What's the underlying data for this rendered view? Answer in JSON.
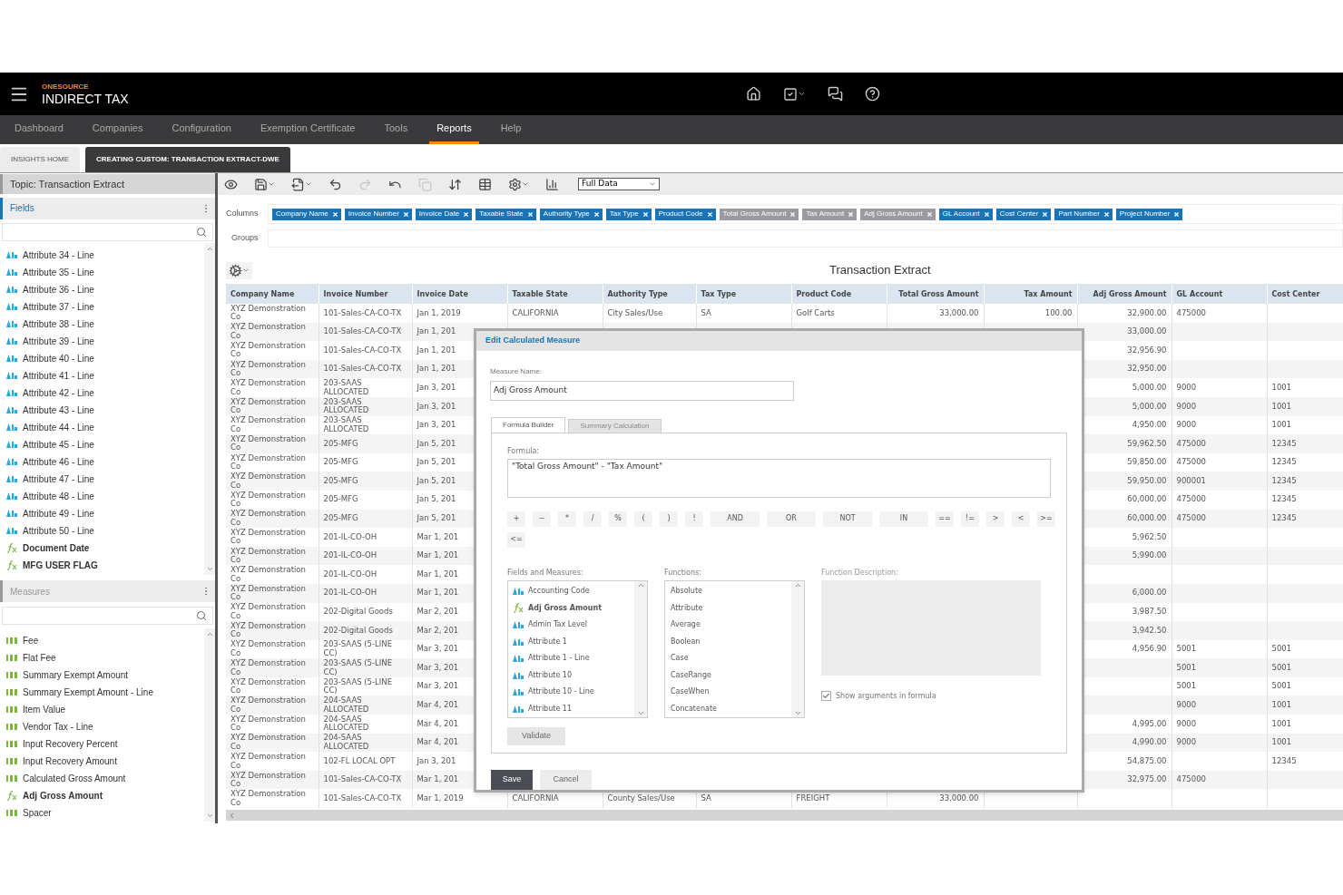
{
  "header": {
    "brand": "ONESOURCE",
    "product": "INDIRECT TAX"
  },
  "nav": [
    {
      "label": "Dashboard",
      "selected": false
    },
    {
      "label": "Companies",
      "selected": false
    },
    {
      "label": "Configuration",
      "selected": false
    },
    {
      "label": "Exemption Certificate",
      "selected": false
    },
    {
      "label": "Tools",
      "selected": false
    },
    {
      "label": "Reports",
      "selected": true
    },
    {
      "label": "Help",
      "selected": false
    }
  ],
  "tabs": [
    {
      "label": "INSIGHTS HOME",
      "selected": false
    },
    {
      "label": "CREATING CUSTOM: TRANSACTION EXTRACT-DWE",
      "selected": true
    }
  ],
  "sidebar": {
    "topic": "Topic: Transaction Extract",
    "fields": {
      "title": "Fields",
      "active": true,
      "items": [
        {
          "label": "Attribute 34 - Line",
          "kind": "text"
        },
        {
          "label": "Attribute 35 - Line",
          "kind": "text"
        },
        {
          "label": "Attribute 36 - Line",
          "kind": "text"
        },
        {
          "label": "Attribute 37 - Line",
          "kind": "text"
        },
        {
          "label": "Attribute 38 - Line",
          "kind": "text"
        },
        {
          "label": "Attribute 39 - Line",
          "kind": "text"
        },
        {
          "label": "Attribute 40 - Line",
          "kind": "text"
        },
        {
          "label": "Attribute 41 - Line",
          "kind": "text"
        },
        {
          "label": "Attribute 42 - Line",
          "kind": "text"
        },
        {
          "label": "Attribute 43 - Line",
          "kind": "text"
        },
        {
          "label": "Attribute 44 - Line",
          "kind": "text"
        },
        {
          "label": "Attribute 45 - Line",
          "kind": "text"
        },
        {
          "label": "Attribute 46 - Line",
          "kind": "text"
        },
        {
          "label": "Attribute 47 - Line",
          "kind": "text"
        },
        {
          "label": "Attribute 48 - Line",
          "kind": "text"
        },
        {
          "label": "Attribute 49 - Line",
          "kind": "text"
        },
        {
          "label": "Attribute 50 - Line",
          "kind": "text"
        },
        {
          "label": "Document Date",
          "kind": "formula"
        },
        {
          "label": "MFG USER FLAG",
          "kind": "formula"
        }
      ]
    },
    "measures": {
      "title": "Measures",
      "active": false,
      "items": [
        {
          "label": "Fee",
          "kind": "number"
        },
        {
          "label": "Flat Fee",
          "kind": "number"
        },
        {
          "label": "Summary Exempt Amount",
          "kind": "number"
        },
        {
          "label": "Summary Exempt Amount - Line",
          "kind": "number"
        },
        {
          "label": "Item Value",
          "kind": "number"
        },
        {
          "label": "Vendor Tax - Line",
          "kind": "number"
        },
        {
          "label": "Input Recovery Percent",
          "kind": "number"
        },
        {
          "label": "Input Recovery Amount",
          "kind": "number"
        },
        {
          "label": "Calculated Gross Amount",
          "kind": "number"
        },
        {
          "label": "Adj Gross Amount",
          "kind": "formula"
        },
        {
          "label": "Spacer",
          "kind": "number"
        }
      ]
    }
  },
  "toolbar": {
    "buttons": [
      {
        "kind": "view",
        "caret": false,
        "disabled": false
      },
      {
        "kind": "save",
        "caret": true,
        "disabled": false
      },
      {
        "kind": "export",
        "caret": true,
        "disabled": false
      },
      {
        "kind": "undo",
        "caret": false,
        "disabled": false
      },
      {
        "kind": "redo",
        "caret": false,
        "disabled": true
      },
      {
        "kind": "reset",
        "caret": false,
        "disabled": false
      },
      {
        "kind": "copy",
        "caret": false,
        "disabled": true
      },
      {
        "kind": "sort",
        "caret": false,
        "disabled": false
      },
      {
        "kind": "layout",
        "caret": false,
        "disabled": false
      },
      {
        "kind": "settings",
        "caret": true,
        "disabled": false
      },
      {
        "kind": "chart",
        "caret": false,
        "disabled": false
      }
    ],
    "view_select": "Full Data"
  },
  "columns_label": "Columns",
  "column_chips": [
    {
      "label": "Company Name",
      "kind": "field"
    },
    {
      "label": "Invoice Number",
      "kind": "field"
    },
    {
      "label": "Invoice Date",
      "kind": "field"
    },
    {
      "label": "Taxable State",
      "kind": "field"
    },
    {
      "label": "Authority Type",
      "kind": "field"
    },
    {
      "label": "Tax Type",
      "kind": "field"
    },
    {
      "label": "Product Code",
      "kind": "field"
    },
    {
      "label": "Total Gross Amount",
      "kind": "measure"
    },
    {
      "label": "Tax Amount",
      "kind": "measure"
    },
    {
      "label": "Adj Gross Amount",
      "kind": "measure"
    },
    {
      "label": "GL Account",
      "kind": "field"
    },
    {
      "label": "Cost Center",
      "kind": "field"
    },
    {
      "label": "Part Number",
      "kind": "field"
    },
    {
      "label": "Project Number",
      "kind": "field"
    }
  ],
  "groups_label": "Groups",
  "report": {
    "title": "Transaction Extract",
    "table": {
      "columns": [
        {
          "label": "Company Name",
          "kind": "text"
        },
        {
          "label": "Invoice Number",
          "kind": "text"
        },
        {
          "label": "Invoice Date",
          "kind": "date"
        },
        {
          "label": "Taxable State",
          "kind": "text"
        },
        {
          "label": "Authority Type",
          "kind": "text"
        },
        {
          "label": "Tax Type",
          "kind": "text"
        },
        {
          "label": "Product Code",
          "kind": "text"
        },
        {
          "label": "Total Gross Amount",
          "kind": "amount"
        },
        {
          "label": "Tax Amount",
          "kind": "amount"
        },
        {
          "label": "Adj Gross Amount",
          "kind": "amount"
        },
        {
          "label": "GL Account",
          "kind": "text"
        },
        {
          "label": "Cost Center",
          "kind": "text"
        }
      ],
      "rows": [
        {
          "cells": [
            "XYZ Demonstration Co",
            "101-Sales-CA-CO-TX",
            "Jan 1, 2019",
            "CALIFORNIA",
            "City Sales/Use",
            "SA",
            "Golf Carts",
            "33,000.00",
            "100.00",
            "32,900.00",
            "475000",
            null
          ]
        },
        {
          "cells": [
            "XYZ Demonstration Co",
            "101-Sales-CA-CO-TX",
            "Jan 1, 201",
            null,
            null,
            null,
            null,
            null,
            null,
            "33,000.00",
            null,
            null
          ]
        },
        {
          "cells": [
            "XYZ Demonstration Co",
            "101-Sales-CA-CO-TX",
            "Jan 1, 201",
            null,
            null,
            null,
            null,
            null,
            null,
            "32,956.90",
            null,
            null
          ]
        },
        {
          "cells": [
            "XYZ Demonstration Co",
            "101-Sales-CA-CO-TX",
            "Jan 1, 201",
            null,
            null,
            null,
            null,
            null,
            null,
            "32,950.00",
            null,
            null
          ]
        },
        {
          "cells": [
            "XYZ Demonstration Co",
            "203-SAAS ALLOCATED",
            "Jan 3, 201",
            null,
            null,
            null,
            null,
            null,
            null,
            "5,000.00",
            "9000",
            "1001"
          ]
        },
        {
          "cells": [
            "XYZ Demonstration Co",
            "203-SAAS ALLOCATED",
            "Jan 3, 201",
            null,
            null,
            null,
            null,
            null,
            null,
            "5,000.00",
            "9000",
            "1001"
          ]
        },
        {
          "cells": [
            "XYZ Demonstration Co",
            "203-SAAS ALLOCATED",
            "Jan 3, 201",
            null,
            null,
            null,
            null,
            null,
            null,
            "4,950.00",
            "9000",
            "1001"
          ]
        },
        {
          "cells": [
            "XYZ Demonstration Co",
            "205-MFG",
            "Jan 5, 201",
            null,
            null,
            null,
            null,
            null,
            null,
            "59,962.50",
            "475000",
            "12345"
          ]
        },
        {
          "cells": [
            "XYZ Demonstration Co",
            "205-MFG",
            "Jan 5, 201",
            null,
            null,
            null,
            null,
            null,
            null,
            "59,850.00",
            "475000",
            "12345"
          ]
        },
        {
          "cells": [
            "XYZ Demonstration Co",
            "205-MFG",
            "Jan 5, 201",
            null,
            null,
            null,
            null,
            null,
            null,
            "59,950.00",
            "900001",
            "12345"
          ]
        },
        {
          "cells": [
            "XYZ Demonstration Co",
            "205-MFG",
            "Jan 5, 201",
            null,
            null,
            null,
            null,
            null,
            null,
            "60,000.00",
            "475000",
            "12345"
          ]
        },
        {
          "cells": [
            "XYZ Demonstration Co",
            "205-MFG",
            "Jan 5, 201",
            null,
            null,
            null,
            null,
            null,
            null,
            "60,000.00",
            "475000",
            "12345"
          ]
        },
        {
          "cells": [
            "XYZ Demonstration Co",
            "201-IL-CO-OH",
            "Mar 1, 201",
            null,
            null,
            null,
            null,
            null,
            null,
            "5,962.50",
            null,
            null
          ]
        },
        {
          "cells": [
            "XYZ Demonstration Co",
            "201-IL-CO-OH",
            "Mar 1, 201",
            null,
            null,
            null,
            null,
            null,
            null,
            "5,990.00",
            null,
            null
          ]
        },
        {
          "cells": [
            "XYZ Demonstration Co",
            "201-IL-CO-OH",
            "Mar 1, 201",
            null,
            null,
            null,
            null,
            null,
            null,
            null,
            null,
            null
          ]
        },
        {
          "cells": [
            "XYZ Demonstration Co",
            "201-IL-CO-OH",
            "Mar 1, 201",
            null,
            null,
            null,
            null,
            null,
            null,
            "6,000.00",
            null,
            null
          ]
        },
        {
          "cells": [
            "XYZ Demonstration Co",
            "202-Digital Goods",
            "Mar 2, 201",
            null,
            null,
            null,
            null,
            null,
            null,
            "3,987.50",
            null,
            null
          ]
        },
        {
          "cells": [
            "XYZ Demonstration Co",
            "202-Digital Goods",
            "Mar 2, 201",
            null,
            null,
            null,
            null,
            null,
            null,
            "3,942.50",
            null,
            null
          ]
        },
        {
          "cells": [
            "XYZ Demonstration Co",
            "203-SAAS (5-LINE CC)",
            "Mar 3, 201",
            null,
            null,
            null,
            null,
            null,
            null,
            "4,956.90",
            "5001",
            "5001"
          ]
        },
        {
          "cells": [
            "XYZ Demonstration Co",
            "203-SAAS (5-LINE CC)",
            "Mar 3, 201",
            null,
            null,
            null,
            null,
            null,
            null,
            null,
            "5001",
            "5001"
          ]
        },
        {
          "cells": [
            "XYZ Demonstration Co",
            "203-SAAS (5-LINE CC)",
            "Mar 3, 201",
            null,
            null,
            null,
            null,
            null,
            null,
            null,
            "5001",
            "5001"
          ]
        },
        {
          "cells": [
            "XYZ Demonstration Co",
            "204-SAAS ALLOCATED",
            "Mar 4, 201",
            null,
            null,
            null,
            null,
            null,
            null,
            null,
            "9000",
            "1001"
          ]
        },
        {
          "cells": [
            "XYZ Demonstration Co",
            "204-SAAS ALLOCATED",
            "Mar 4, 201",
            null,
            null,
            null,
            null,
            null,
            null,
            "4,995.00",
            "9000",
            "1001"
          ]
        },
        {
          "cells": [
            "XYZ Demonstration Co",
            "204-SAAS ALLOCATED",
            "Mar 4, 201",
            null,
            null,
            null,
            null,
            null,
            null,
            "4,990.00",
            "9000",
            "1001"
          ]
        },
        {
          "cells": [
            "XYZ Demonstration Co",
            "102-FL LOCAL OPT",
            "Jan 3, 201",
            null,
            null,
            null,
            null,
            null,
            null,
            "54,875.00",
            null,
            "12345"
          ]
        },
        {
          "cells": [
            "XYZ Demonstration Co",
            "101-Sales-CA-CO-TX",
            "Mar 1, 201",
            null,
            null,
            null,
            null,
            null,
            null,
            "32,975.00",
            "475000",
            null
          ]
        },
        {
          "cells": [
            "XYZ Demonstration Co",
            "101-Sales-CA-CO-TX",
            "Mar 1, 2019",
            "CALIFORNIA",
            "County Sales/Use",
            "SA",
            "FREIGHT",
            "33,000.00",
            null,
            null,
            null,
            null
          ]
        }
      ]
    }
  },
  "dialog": {
    "title": "Edit Calculated Measure",
    "name_label": "Measure Name:",
    "name_value": "Adj Gross Amount",
    "tabs": [
      {
        "label": "Formula Builder",
        "selected": true
      },
      {
        "label": "Summary Calculation",
        "selected": false
      }
    ],
    "formula_label": "Formula:",
    "formula_value": "\"Total Gross Amount\" - \"Tax Amount\"",
    "operators": [
      "+",
      "−",
      "*",
      "/",
      "%",
      "(",
      ")",
      "!",
      "AND",
      "OR",
      "NOT",
      "IN",
      "==",
      "!=",
      ">",
      "<",
      ">=",
      "<="
    ],
    "fields_label": "Fields and Measures:",
    "fields": [
      {
        "label": "Accounting Code",
        "kind": "text"
      },
      {
        "label": "Adj Gross Amount",
        "kind": "formula"
      },
      {
        "label": "Admin Tax Level",
        "kind": "text"
      },
      {
        "label": "Attribute 1",
        "kind": "text"
      },
      {
        "label": "Attribute 1 - Line",
        "kind": "text"
      },
      {
        "label": "Attribute 10",
        "kind": "text"
      },
      {
        "label": "Attribute 10 - Line",
        "kind": "text"
      },
      {
        "label": "Attribute 11",
        "kind": "text"
      }
    ],
    "functions_label": "Functions:",
    "functions": [
      "Absolute",
      "Attribute",
      "Average",
      "Boolean",
      "Case",
      "CaseRange",
      "CaseWhen",
      "Concatenate"
    ],
    "description_label": "Function Description:",
    "show_arguments": {
      "label": "Show arguments in formula",
      "checked": true
    },
    "validate": "Validate",
    "save": "Save",
    "cancel": "Cancel"
  }
}
